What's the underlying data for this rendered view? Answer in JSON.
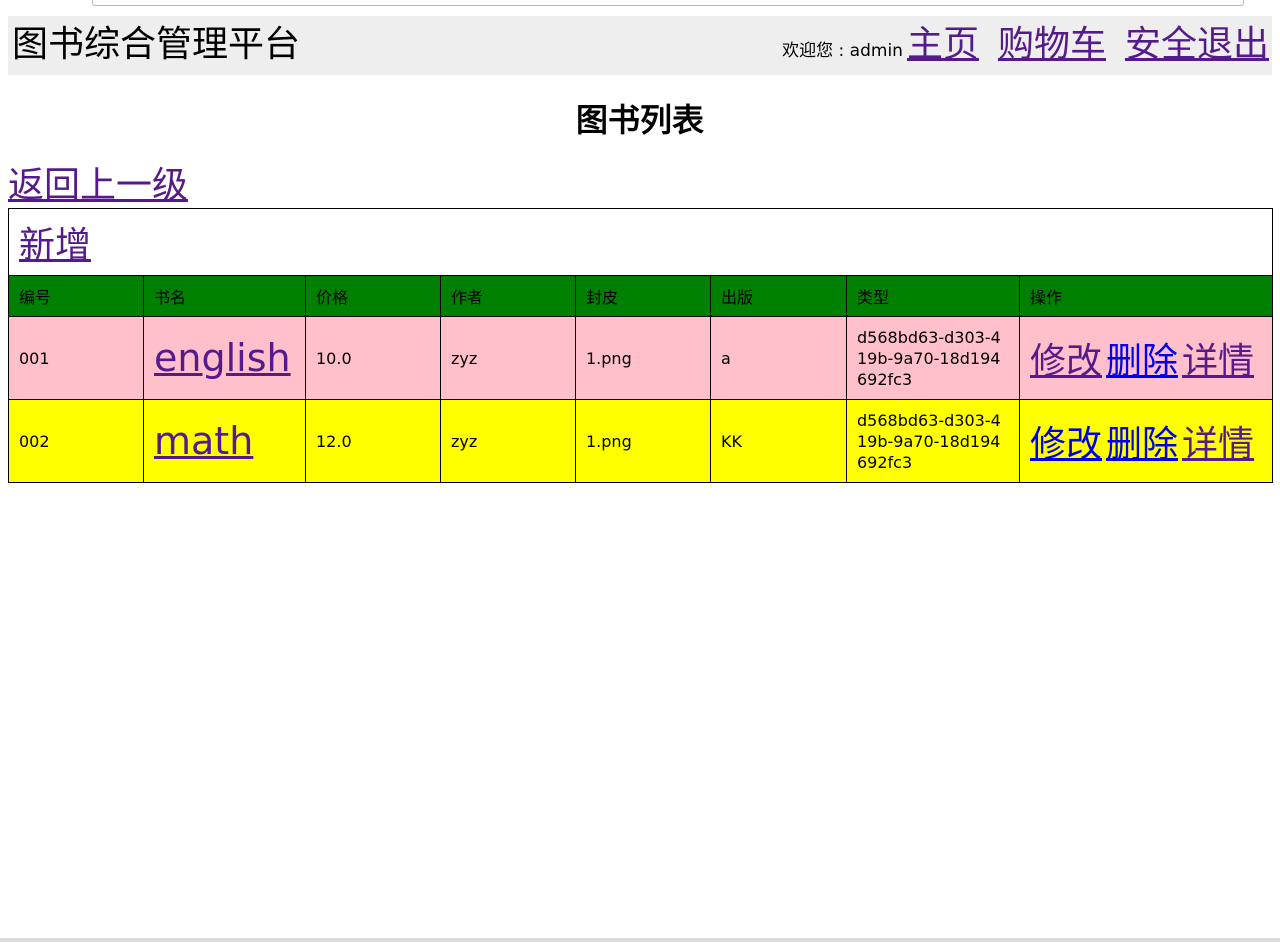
{
  "header": {
    "site_title": "图书综合管理平台",
    "welcome_text": "欢迎您 : admin",
    "nav_links": [
      "主页",
      "购物车",
      "安全退出"
    ]
  },
  "page": {
    "heading": "图书列表",
    "back_link": "返回上一级",
    "add_link": "新增"
  },
  "table": {
    "columns": [
      "编号",
      "书名",
      "价格",
      "作者",
      "封皮",
      "出版",
      "类型",
      "操作"
    ],
    "rows": [
      {
        "id": "001",
        "name": "english",
        "price": "10.0",
        "author": "zyz",
        "cover": "1.png",
        "publisher": "a",
        "type": "d568bd63-d303-419b-9a70-18d194692fc3",
        "actions": [
          "修改",
          "删除",
          "详情"
        ]
      },
      {
        "id": "002",
        "name": "math",
        "price": "12.0",
        "author": "zyz",
        "cover": "1.png",
        "publisher": "KK",
        "type": "d568bd63-d303-419b-9a70-18d194692fc3",
        "actions": [
          "修改",
          "删除",
          "详情"
        ]
      }
    ],
    "row_colors": [
      "#ffc0cb",
      "#ffff00"
    ],
    "header_color": "#008000"
  },
  "colors": {
    "visited_link": "#551a8b",
    "unvisited_link": "#0000ee",
    "header_bg": "#eeeeee"
  }
}
